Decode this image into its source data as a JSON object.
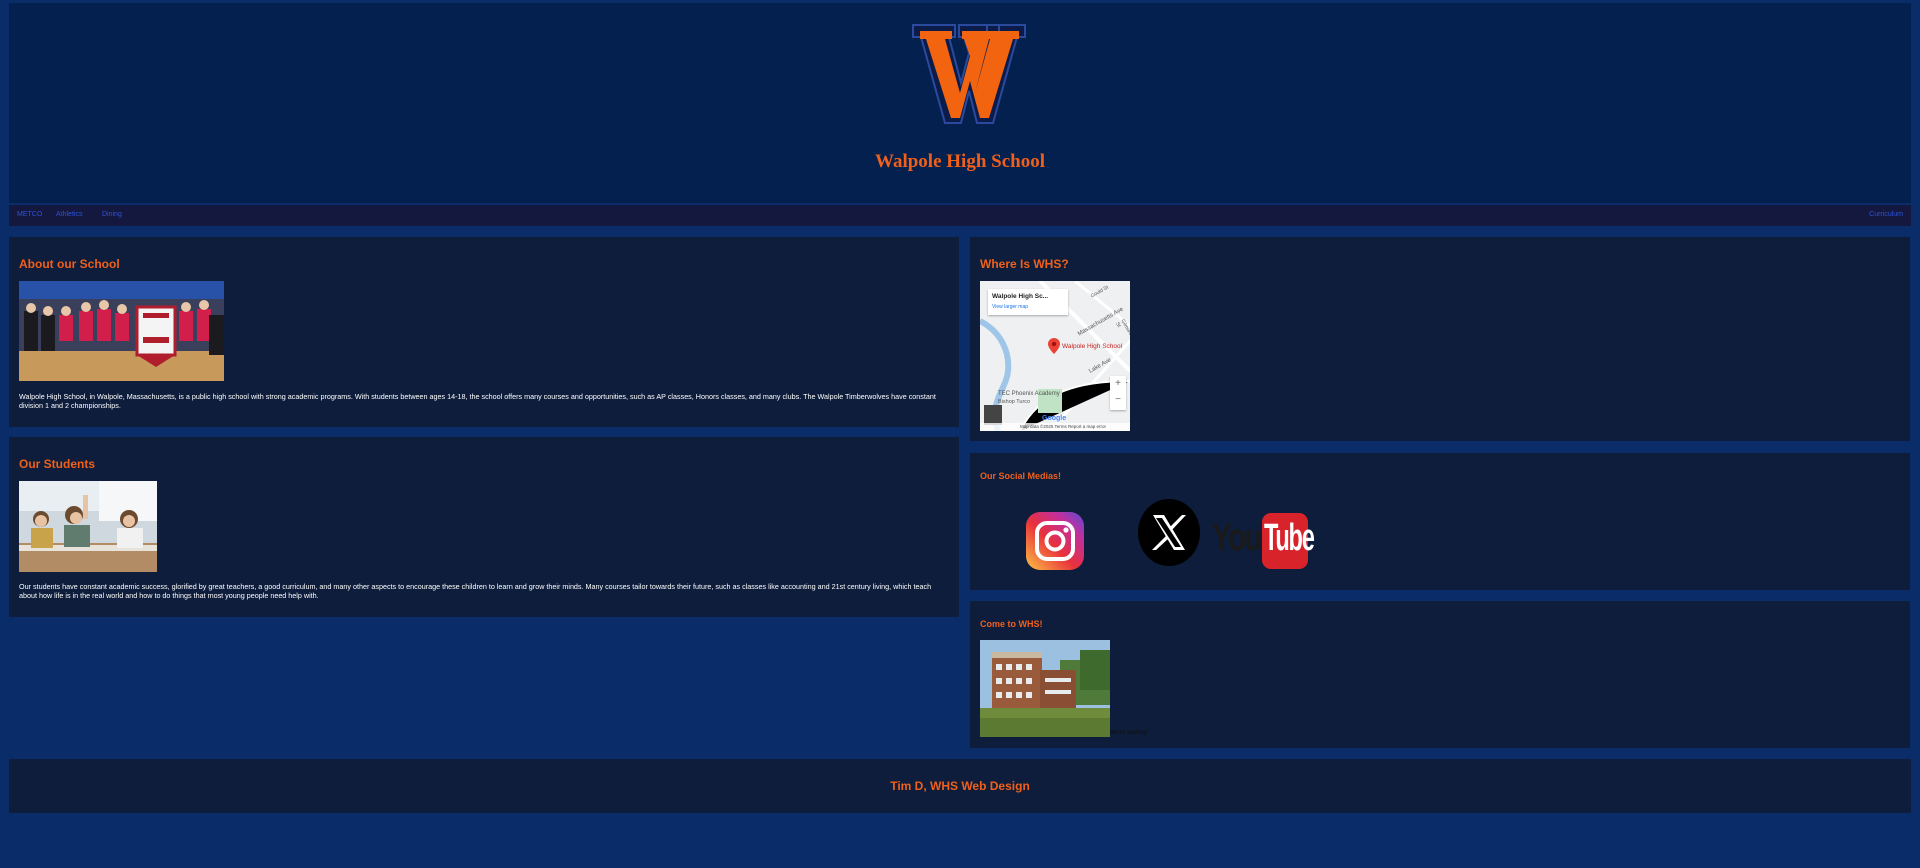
{
  "header": {
    "logo_letter": "W",
    "school_name": "Walpole High School"
  },
  "nav": {
    "links": [
      "METCO",
      "Athletics",
      "Dining"
    ],
    "right_link": "Curriculum"
  },
  "about": {
    "title": "About our School",
    "text": "Walpole High School, in Walpole, Massachusetts, is a public high school with strong academic programs. With students between ages 14-18, the school offers many courses and opportunities, such as AP classes, Honors classes, and many clubs. The Walpole Timberwolves have constant division 1 and 2 championships."
  },
  "students": {
    "title": "Our Students",
    "text": "Our students have constant academic success, glorified by great teachers, a good curriculum, and many other aspects to encourage these children to learn and grow their minds. Many courses tailor towards their future, such as classes like accounting and 21st century living, which teach about how life is in the real world and how to do things that most young people need help with."
  },
  "map_panel": {
    "title": "Where Is WHS?",
    "card_title": "Walpole High Sc...",
    "card_link": "View larger map",
    "pin_label": "Walpole High School",
    "street_1": "Massachusetts Ave",
    "street_2": "Lake Ave",
    "street_3": "Gould St",
    "street_4": "Gilmore St",
    "place_label": "TEC Phoenix Academy",
    "place_label_2": "Bishop Turco",
    "google_text": "Google",
    "footer_text": "Map data ©2025  Terms  Report a map error",
    "zoom_in": "+",
    "zoom_out": "−"
  },
  "social": {
    "title": "Our Social Medias!",
    "youtube_you": "You",
    "youtube_tube": "Tube"
  },
  "visit": {
    "title": "Come to WHS!",
    "caption": "We're waiting!"
  },
  "footer": {
    "text": "Tim D, WHS Web Design"
  },
  "colors": {
    "accent": "#f0601a",
    "page_bg": "#0a2c68",
    "header_bg": "#03204f",
    "panel_bg": "#0d1d3b",
    "nav_link": "#2d52d8"
  }
}
